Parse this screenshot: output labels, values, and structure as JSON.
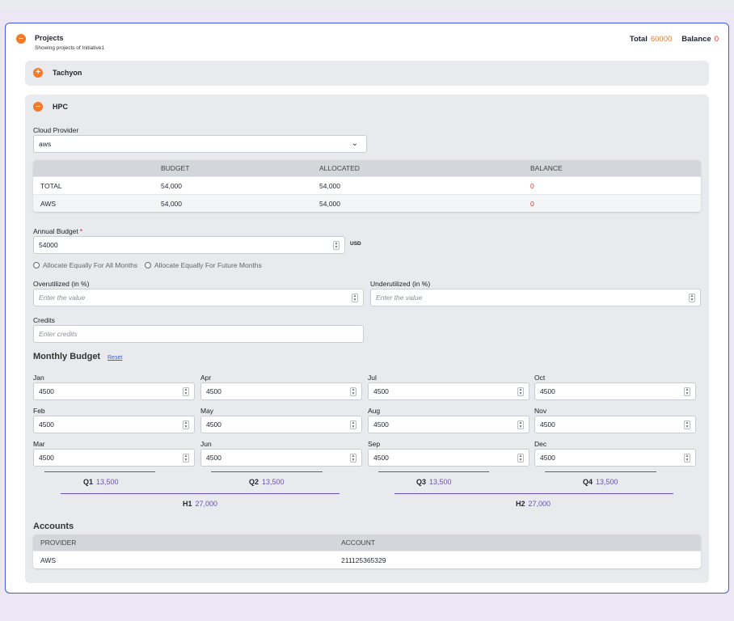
{
  "project": {
    "title": "Projects",
    "subtitle": "Showing projects of Initiative1",
    "total_label": "Total",
    "total_value": "60000",
    "balance_label": "Balance",
    "balance_value": "0"
  },
  "tachyon": {
    "name": "Tachyon"
  },
  "hpc": {
    "name": "HPC",
    "cloud_provider_label": "Cloud Provider",
    "cloud_provider_value": "aws",
    "summary": {
      "headers": [
        "",
        "BUDGET",
        "ALLOCATED",
        "BALANCE"
      ],
      "rows": [
        [
          "TOTAL",
          "54,000",
          "54,000",
          "0"
        ],
        [
          "AWS",
          "54,000",
          "54,000",
          "0"
        ]
      ]
    },
    "annual_budget_label": "Annual Budget",
    "required_mark": "*",
    "annual_budget_value": "54000",
    "currency": "USD",
    "allocate_all": "Allocate Equally For All Months",
    "allocate_future": "Allocate Equally For Future Months",
    "over_label": "Overutilized (in %)",
    "over_placeholder": "Enter the value",
    "under_label": "Underutilized (in %)",
    "under_placeholder": "Enter the value",
    "credits_label": "Credits",
    "credits_placeholder": "Enter credits",
    "monthly_title": "Monthly Budget",
    "reset_label": "Reset",
    "months": {
      "jan": {
        "label": "Jan",
        "value": "4500"
      },
      "feb": {
        "label": "Feb",
        "value": "4500"
      },
      "mar": {
        "label": "Mar",
        "value": "4500"
      },
      "apr": {
        "label": "Apr",
        "value": "4500"
      },
      "may": {
        "label": "May",
        "value": "4500"
      },
      "jun": {
        "label": "Jun",
        "value": "4500"
      },
      "jul": {
        "label": "Jul",
        "value": "4500"
      },
      "aug": {
        "label": "Aug",
        "value": "4500"
      },
      "sep": {
        "label": "Sep",
        "value": "4500"
      },
      "oct": {
        "label": "Oct",
        "value": "4500"
      },
      "nov": {
        "label": "Nov",
        "value": "4500"
      },
      "dec": {
        "label": "Dec",
        "value": "4500"
      }
    },
    "quarters": {
      "q1": {
        "label": "Q1",
        "value": "13,500"
      },
      "q2": {
        "label": "Q2",
        "value": "13,500"
      },
      "q3": {
        "label": "Q3",
        "value": "13,500"
      },
      "q4": {
        "label": "Q4",
        "value": "13,500"
      }
    },
    "halves": {
      "h1": {
        "label": "H1",
        "value": "27,000"
      },
      "h2": {
        "label": "H2",
        "value": "27,000"
      }
    },
    "accounts": {
      "title": "Accounts",
      "headers": [
        "PROVIDER",
        "ACCOUNT"
      ],
      "rows": [
        [
          "AWS",
          "211125365329"
        ]
      ]
    }
  },
  "colors": {
    "accent": "#f47a28",
    "border": "#3d5bd9",
    "quarter": "#6b4fbf",
    "negative": "#e0322b"
  }
}
